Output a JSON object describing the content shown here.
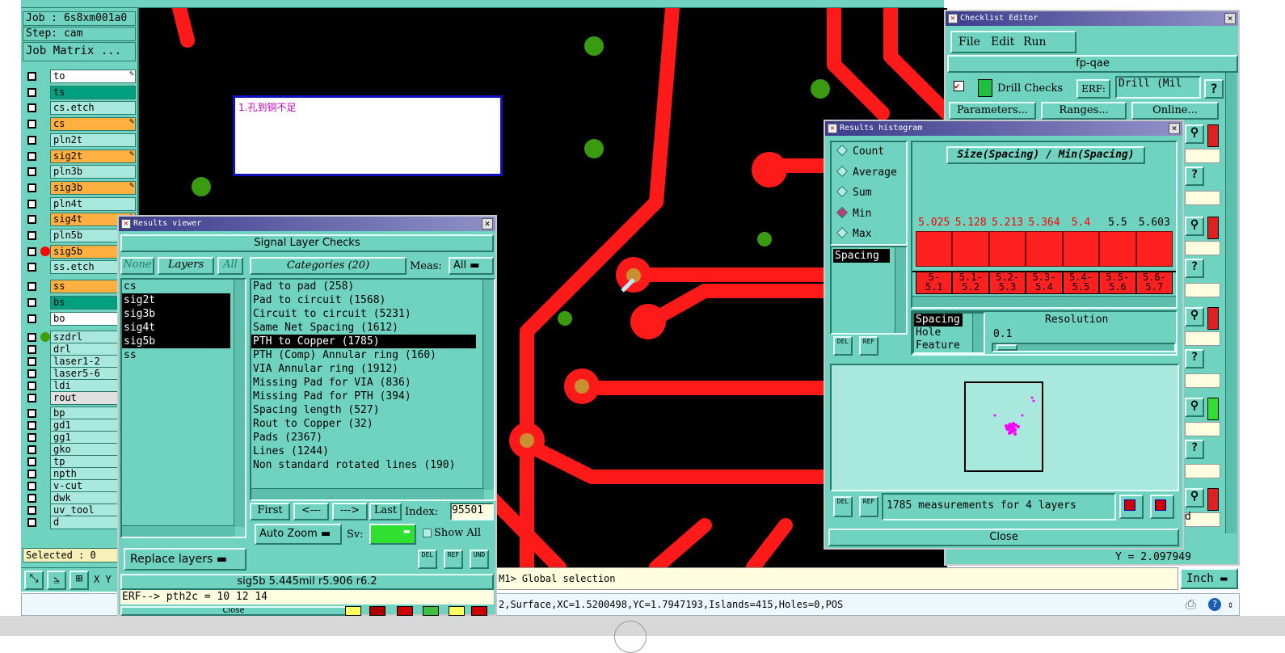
{
  "left_panel": {
    "job": "Job : 6s8xm001a0",
    "step": "Step: cam",
    "job_matrix": "Job Matrix ...",
    "layers": [
      {
        "name": "to",
        "bg": "#ffffff",
        "pen": true
      },
      {
        "name": "ts",
        "bg": "#00a080",
        "pen": false
      },
      {
        "name": "cs.etch",
        "bg": "#a8e8dd",
        "pen": false
      },
      {
        "name": "cs",
        "bg": "#ffb040",
        "pen": true
      },
      {
        "name": "pln2t",
        "bg": "#a8e8dd",
        "pen": false
      },
      {
        "name": "sig2t",
        "bg": "#ffb040",
        "pen": true
      },
      {
        "name": "pln3b",
        "bg": "#a8e8dd",
        "pen": false
      },
      {
        "name": "sig3b",
        "bg": "#ffb040",
        "pen": true
      },
      {
        "name": "pln4t",
        "bg": "#a8e8dd",
        "pen": false
      },
      {
        "name": "sig4t",
        "bg": "#ffb040",
        "pen": true
      },
      {
        "name": "pln5b",
        "bg": "#a8e8dd",
        "pen": false
      },
      {
        "name": "sig5b",
        "bg": "#ffb040",
        "pen": true,
        "dot": "#ff0000"
      },
      {
        "name": "ss.etch",
        "bg": "#a8e8dd",
        "pen": false
      },
      {
        "name": "ss",
        "bg": "#ffb040",
        "pen": true
      },
      {
        "name": "bs",
        "bg": "#00a080",
        "pen": false
      },
      {
        "name": "bo",
        "bg": "#ffffff",
        "pen": false
      },
      {
        "name": "szdrl",
        "bg": "#a8e8dd",
        "pen": false,
        "dot": "#40a000"
      },
      {
        "name": "drl",
        "bg": "#a8e8dd",
        "pen": false
      },
      {
        "name": "laser1-2",
        "bg": "#a8e8dd",
        "pen": false
      },
      {
        "name": "laser5-6",
        "bg": "#a8e8dd",
        "pen": false
      },
      {
        "name": "ldi",
        "bg": "#a8e8dd",
        "pen": false
      },
      {
        "name": "rout",
        "bg": "#e0e0e0",
        "pen": false
      },
      {
        "name": "bp",
        "bg": "#a8e8dd",
        "pen": false
      },
      {
        "name": "gd1",
        "bg": "#a8e8dd",
        "pen": true
      },
      {
        "name": "gg1",
        "bg": "#a8e8dd",
        "pen": false
      },
      {
        "name": "gko",
        "bg": "#a8e8dd",
        "pen": false
      },
      {
        "name": "tp",
        "bg": "#a8e8dd",
        "pen": false
      },
      {
        "name": "npth",
        "bg": "#a8e8dd",
        "pen": false
      },
      {
        "name": "v-cut",
        "bg": "#a8e8dd",
        "pen": false
      },
      {
        "name": "dwk",
        "bg": "#a8e8dd",
        "pen": false
      },
      {
        "name": "uv_tool",
        "bg": "#a8e8dd",
        "pen": false
      },
      {
        "name": "d",
        "bg": "#a8e8dd",
        "pen": false
      }
    ],
    "selected": "Selected : 0",
    "xy_label": "X Y"
  },
  "canvas": {
    "note_text": "1.孔到铜不足",
    "status_line": "M1> Global selection",
    "bottom_status": "2,Surface,XC=1.5200498,YC=1.7947193,Islands=415,Holes=0,POS",
    "units": "Inch"
  },
  "results_viewer": {
    "title": "Results viewer",
    "header": "Signal Layer Checks",
    "none_btn": "None",
    "layers_btn": "Layers",
    "all_btn": "All",
    "layers": [
      {
        "name": "cs",
        "selected": false
      },
      {
        "name": "sig2t",
        "selected": true
      },
      {
        "name": "sig3b",
        "selected": true
      },
      {
        "name": "sig4t",
        "selected": true
      },
      {
        "name": "sig5b",
        "selected": true
      },
      {
        "name": "ss",
        "selected": false
      }
    ],
    "categories_title": "Categories (20)",
    "meas_label": "Meas:",
    "meas_value": "All",
    "categories": [
      {
        "label": "Pad to pad (258)",
        "selected": false
      },
      {
        "label": "Pad to circuit (1568)",
        "selected": false
      },
      {
        "label": "Circuit to circuit (5231)",
        "selected": false
      },
      {
        "label": "Same Net Spacing (1612)",
        "selected": false
      },
      {
        "label": "PTH to Copper (1785)",
        "selected": true
      },
      {
        "label": "PTH (Comp) Annular ring (160)",
        "selected": false
      },
      {
        "label": "VIA Annular ring (1912)",
        "selected": false
      },
      {
        "label": "Missing Pad for VIA (836)",
        "selected": false
      },
      {
        "label": "Missing Pad for PTH (394)",
        "selected": false
      },
      {
        "label": "Spacing length (527)",
        "selected": false
      },
      {
        "label": "Rout to Copper (32)",
        "selected": false
      },
      {
        "label": "Pads (2367)",
        "selected": false
      },
      {
        "label": "Lines (1244)",
        "selected": false
      },
      {
        "label": "Non standard rotated lines (190)",
        "selected": false
      }
    ],
    "first": "First",
    "prev": "<---",
    "next": "--->",
    "last": "Last",
    "index_label": "Index:",
    "index_value": "95501",
    "zoom": "Auto Zoom",
    "sv_label": "Sv:",
    "show_all": "Show All",
    "replace_layers": "Replace layers",
    "del": "DEL",
    "ref": "REF",
    "undo": "UND",
    "info_line": "sig5b 5.445mil  r5.906  r6.2",
    "erf_line": "ERF--> pth2c = 10 12 14",
    "close": "Close"
  },
  "checklist": {
    "title": "Checklist Editor",
    "menu": [
      "File",
      "Edit",
      "Run"
    ],
    "name": "fp-qae",
    "check_name": "Drill Checks",
    "erf_label": "ERF:",
    "erf_value": "Drill (Mil",
    "parameters": "Parameters...",
    "ranges": "Ranges...",
    "online": "Online...",
    "help": "?",
    "y_value": "Y = 2.097949",
    "d_char": "d"
  },
  "histogram": {
    "title": "Results histogram",
    "modes": [
      {
        "label": "Count",
        "on": false
      },
      {
        "label": "Average",
        "on": false
      },
      {
        "label": "Sum",
        "on": false
      },
      {
        "label": "Min",
        "on": true
      },
      {
        "label": "Max",
        "on": false
      }
    ],
    "chart_title": "Size(Spacing) / Min(Spacing)",
    "left_list_item": "Spacing",
    "bins": [
      {
        "value": "5.025",
        "range": "5-\n5.1"
      },
      {
        "value": "5.128",
        "range": "5.1-\n5.2"
      },
      {
        "value": "5.213",
        "range": "5.2-\n5.3"
      },
      {
        "value": "5.364",
        "range": "5.3-\n5.4"
      },
      {
        "value": "5.4",
        "range": "5.4-\n5.5"
      },
      {
        "value": "5.5",
        "range": "5.5-\n5.6"
      },
      {
        "value": "5.603",
        "range": "5.6-\n5.7"
      }
    ],
    "options": [
      {
        "label": "Spacing",
        "selected": true
      },
      {
        "label": "Hole",
        "selected": false
      },
      {
        "label": "Feature",
        "selected": false
      }
    ],
    "resolution_label": "Resolution",
    "resolution_value": "0.1",
    "measurements": "1785 measurements for 4 layers",
    "del": "DEL",
    "ref": "REF",
    "close": "Close"
  },
  "chart_data": {
    "type": "bar",
    "title": "Size(Spacing) / Min(Spacing)",
    "categories": [
      "5-5.1",
      "5.1-5.2",
      "5.2-5.3",
      "5.3-5.4",
      "5.4-5.5",
      "5.5-5.6",
      "5.6-5.7"
    ],
    "values": [
      5.025,
      5.128,
      5.213,
      5.364,
      5.4,
      5.5,
      5.603
    ]
  }
}
